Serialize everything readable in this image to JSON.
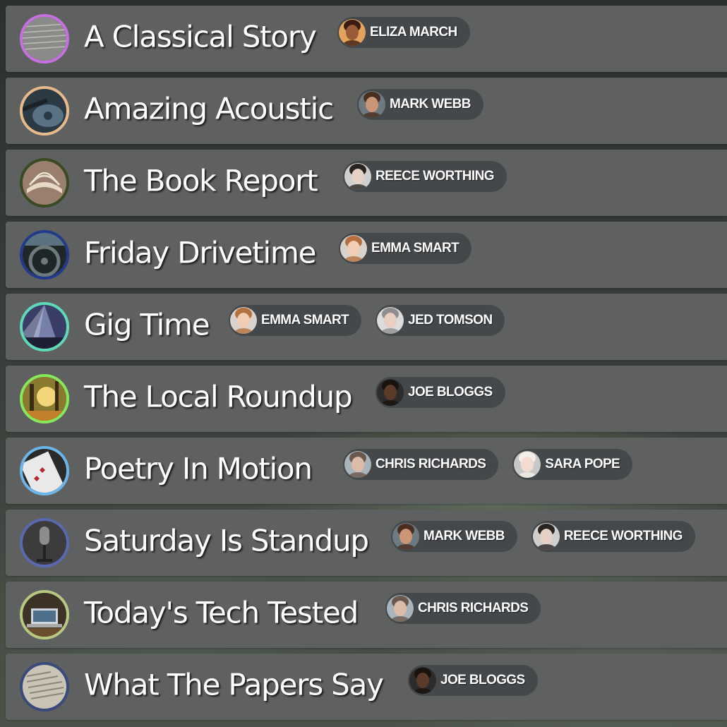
{
  "shows": [
    {
      "title": "A Classical Story",
      "ring_color": "#c56fe0",
      "thumb": {
        "bg": "#8a8a88",
        "fg": "#c9c9c5",
        "icon": "sheet-music-icon"
      },
      "hosts": [
        {
          "name": "ELIZA MARCH",
          "skin": "#9a5b37",
          "hair": "#3a1d10",
          "bg": "#e3a35f"
        }
      ]
    },
    {
      "title": "Amazing Acoustic",
      "ring_color": "#e8b98a",
      "thumb": {
        "bg": "#2c3a44",
        "fg": "#5a7286",
        "icon": "guitar-icon"
      },
      "hosts": [
        {
          "name": "MARK WEBB",
          "skin": "#c99677",
          "hair": "#4a2e1f",
          "bg": "#6e7a80"
        }
      ]
    },
    {
      "title": "The Book Report",
      "ring_color": "#3a4a22",
      "thumb": {
        "bg": "#9a7f6e",
        "fg": "#e8d8c8",
        "icon": "open-book-icon"
      },
      "hosts": [
        {
          "name": "REECE WORTHING",
          "skin": "#e6d2c4",
          "hair": "#2a2420",
          "bg": "#cfcfcf"
        }
      ]
    },
    {
      "title": "Friday Drivetime",
      "ring_color": "#223a8a",
      "thumb": {
        "bg": "#1e2628",
        "fg": "#6c7a7c",
        "icon": "steering-wheel-icon"
      },
      "hosts": [
        {
          "name": "EMMA SMART",
          "skin": "#f0cdb4",
          "hair": "#b5703f",
          "bg": "#d9d2cc"
        }
      ]
    },
    {
      "title": "Gig Time",
      "ring_color": "#5fd9b9",
      "thumb": {
        "bg": "#3a3e66",
        "fg": "#b4c2ee",
        "icon": "concert-icon"
      },
      "hosts": [
        {
          "name": "EMMA SMART",
          "skin": "#f0cdb4",
          "hair": "#b5703f",
          "bg": "#d9d2cc"
        },
        {
          "name": "JED TOMSON",
          "skin": "#e9cfc2",
          "hair": "#8e8e8e",
          "bg": "#dcdcdc"
        }
      ]
    },
    {
      "title": "The Local Roundup",
      "ring_color": "#86e85a",
      "thumb": {
        "bg": "#8a7a30",
        "fg": "#f3d67a",
        "icon": "sunlit-trees-icon"
      },
      "hosts": [
        {
          "name": "JOE BLOGGS",
          "skin": "#5a3a28",
          "hair": "#1c120c",
          "bg": "#2c2c2c"
        }
      ]
    },
    {
      "title": "Poetry In Motion",
      "ring_color": "#6ab6ea",
      "thumb": {
        "bg": "#e9e9e9",
        "fg": "#b52b2b",
        "icon": "playing-card-icon"
      },
      "hosts": [
        {
          "name": "CHRIS RICHARDS",
          "skin": "#dcbca8",
          "hair": "#6a584c",
          "bg": "#a9b4bc"
        },
        {
          "name": "SARA POPE",
          "skin": "#f2dcd2",
          "hair": "#f4efe6",
          "bg": "#c8c8c8"
        }
      ]
    },
    {
      "title": "Saturday Is Standup",
      "ring_color": "#5a68b0",
      "thumb": {
        "bg": "#3c3c3c",
        "fg": "#8c8c8c",
        "icon": "microphone-icon"
      },
      "hosts": [
        {
          "name": "MARK WEBB",
          "skin": "#c99677",
          "hair": "#4a2e1f",
          "bg": "#6e7a80"
        },
        {
          "name": "REECE WORTHING",
          "skin": "#e6d2c4",
          "hair": "#2a2420",
          "bg": "#cfcfcf"
        }
      ]
    },
    {
      "title": "Today's Tech Tested",
      "ring_color": "#b9c880",
      "thumb": {
        "bg": "#3c3226",
        "fg": "#cfd6dc",
        "icon": "laptop-icon"
      },
      "hosts": [
        {
          "name": "CHRIS RICHARDS",
          "skin": "#dcbca8",
          "hair": "#6a584c",
          "bg": "#a9b4bc"
        }
      ]
    },
    {
      "title": "What The Papers Say",
      "ring_color": "#3a4a7a",
      "thumb": {
        "bg": "#c9c4b6",
        "fg": "#8a8678",
        "icon": "newspaper-icon"
      },
      "hosts": [
        {
          "name": "JOE BLOGGS",
          "skin": "#5a3a28",
          "hair": "#1c120c",
          "bg": "#2c2c2c"
        }
      ]
    }
  ]
}
